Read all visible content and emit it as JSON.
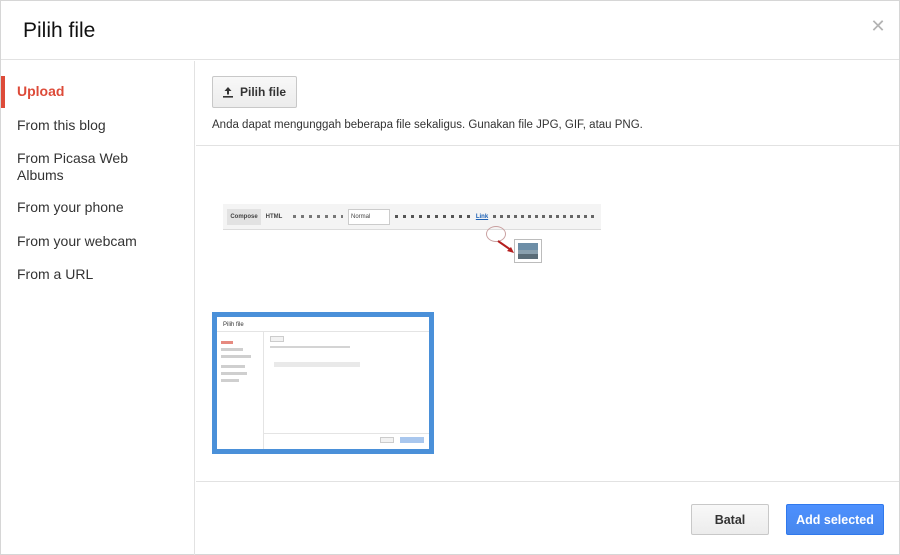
{
  "dialog": {
    "title": "Pilih file",
    "close_icon": "close-icon"
  },
  "sidebar": {
    "items": [
      {
        "label": "Upload",
        "active": true
      },
      {
        "label": "From this blog",
        "active": false
      },
      {
        "label": "From Picasa Web Albums",
        "active": false
      },
      {
        "label": "From your phone",
        "active": false
      },
      {
        "label": "From your webcam",
        "active": false
      },
      {
        "label": "From a URL",
        "active": false
      }
    ]
  },
  "upload": {
    "button_label": "Pilih file",
    "button_icon": "upload-icon",
    "hint": "Anda dapat mengunggah beberapa file sekaligus. Gunakan file JPG, GIF, atau PNG."
  },
  "illustration": {
    "toolbar_labels": [
      "Compose",
      "HTML"
    ],
    "font_select": "Normal",
    "link_label": "Link"
  },
  "footer": {
    "cancel_label": "Batal",
    "add_label": "Add selected"
  },
  "colors": {
    "active_nav": "#dd4b39",
    "primary_button": "#4d90fe",
    "selection_border": "#4a90d9"
  }
}
